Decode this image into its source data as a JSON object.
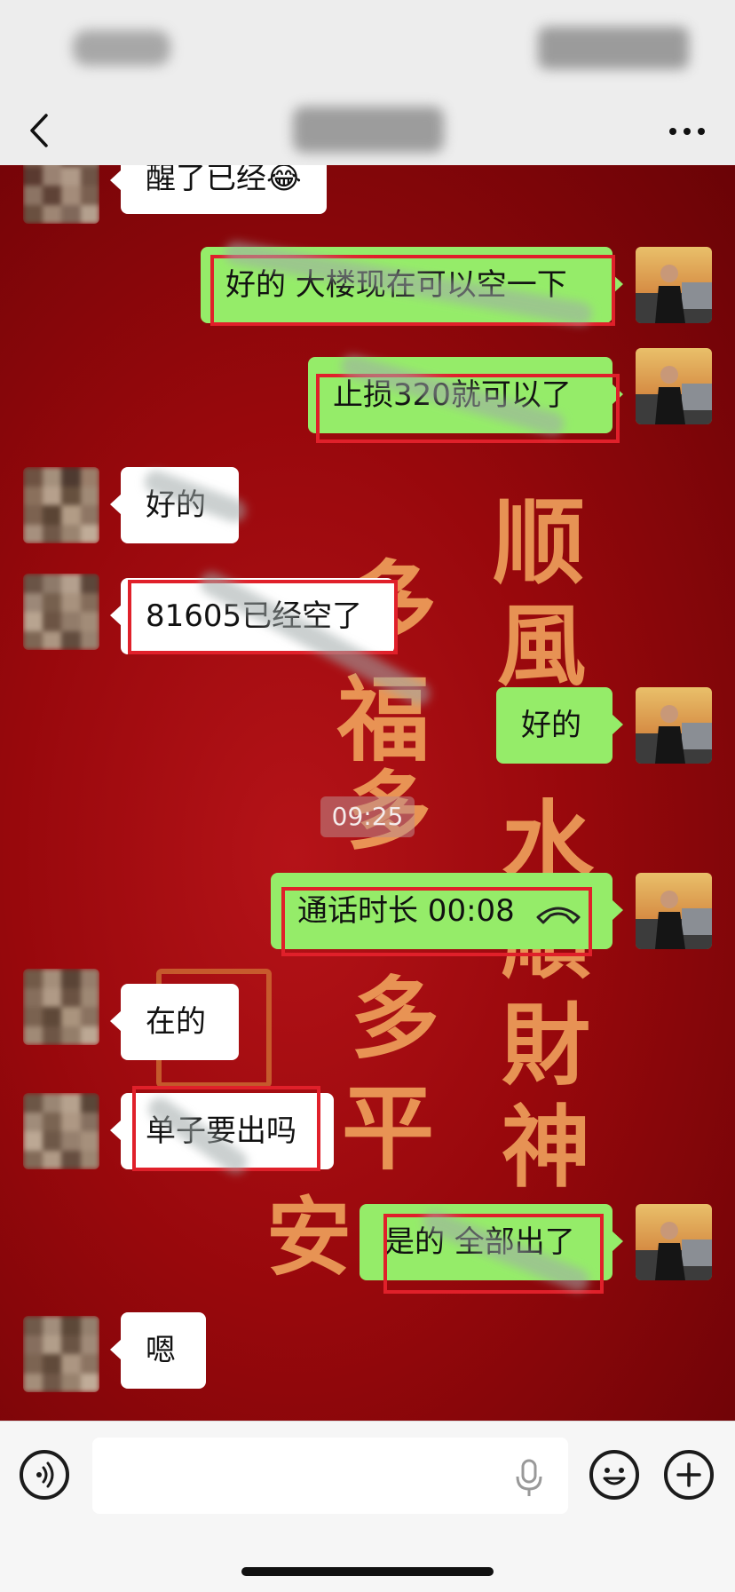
{
  "chat": {
    "background_watermark": [
      "顺",
      "風",
      "多",
      "福",
      "多",
      "水",
      "順",
      "財",
      "神",
      "多",
      "平",
      "安"
    ],
    "messages": [
      {
        "side": "other",
        "text": "醒了已经😂"
      },
      {
        "side": "me",
        "text": "好的 大楼现在可以空一下"
      },
      {
        "side": "me",
        "text": "止损320就可以了"
      },
      {
        "side": "other",
        "text": "好的"
      },
      {
        "side": "other",
        "text": "81605已经空了"
      },
      {
        "side": "me",
        "text": "好的"
      },
      {
        "side": "me",
        "text": "通话时长 00:08"
      },
      {
        "side": "other",
        "text": "在的"
      },
      {
        "side": "other",
        "text": "单子要出吗"
      },
      {
        "side": "me",
        "text": "是的 全部出了"
      },
      {
        "side": "other",
        "text": "嗯"
      }
    ],
    "timestamp": "09:25"
  },
  "input_bar": {
    "placeholder": "",
    "icons": [
      "voice-icon",
      "microphone-icon",
      "emoji-icon",
      "plus-icon"
    ]
  },
  "colors": {
    "bubble_me": "#95ec69",
    "bubble_other": "#ffffff",
    "annotation_red": "#e0202a",
    "bar_background": "#ededed"
  }
}
